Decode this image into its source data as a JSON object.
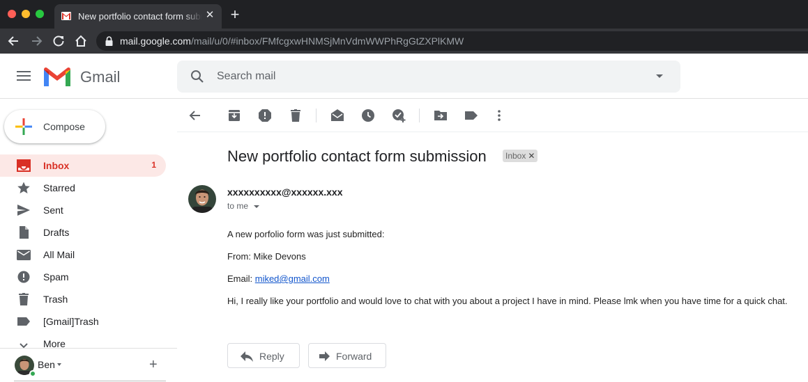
{
  "browser": {
    "tab_title": "New portfolio contact form submission",
    "url_host": "mail.google.com",
    "url_path": "/mail/u/0/#inbox/FMfcgxwHNMSjMnVdmWWPhRgGtZXPlKMW"
  },
  "header": {
    "app_name": "Gmail",
    "search_placeholder": "Search mail"
  },
  "sidebar": {
    "compose_label": "Compose",
    "items": [
      {
        "label": "Inbox",
        "icon": "inbox-icon",
        "count": "1",
        "active": true
      },
      {
        "label": "Starred",
        "icon": "star-icon"
      },
      {
        "label": "Sent",
        "icon": "send-icon"
      },
      {
        "label": "Drafts",
        "icon": "draft-icon"
      },
      {
        "label": "All Mail",
        "icon": "mail-icon"
      },
      {
        "label": "Spam",
        "icon": "spam-icon"
      },
      {
        "label": "Trash",
        "icon": "trash-icon"
      },
      {
        "label": "[Gmail]Trash",
        "icon": "label-icon"
      },
      {
        "label": "More",
        "icon": "chevron-down-icon"
      }
    ],
    "hangouts_user": "Ben"
  },
  "toolbar": {
    "icons": [
      "back-icon",
      "archive-icon",
      "report-spam-icon",
      "delete-icon",
      "mark-unread-icon",
      "snooze-icon",
      "add-to-tasks-icon",
      "move-to-icon",
      "labels-icon",
      "more-icon"
    ]
  },
  "message": {
    "subject": "New portfolio contact form submission",
    "label": "Inbox",
    "sender": "xxxxxxxxxx@xxxxxx.xxx",
    "recipient": "to me",
    "body": {
      "intro": "A new porfolio form was just submitted:",
      "from": "From: Mike Devons",
      "email_prefix": "Email: ",
      "email_link": "miked@gmail.com",
      "message": "Hi, I really like your portfolio and would love to chat with you about a project I have in mind. Please lmk when you have time for a quick chat."
    },
    "reply_label": "Reply",
    "forward_label": "Forward"
  },
  "colors": {
    "gmail_red": "#d93025",
    "active_bg": "#fce8e6",
    "link": "#1155cc"
  }
}
